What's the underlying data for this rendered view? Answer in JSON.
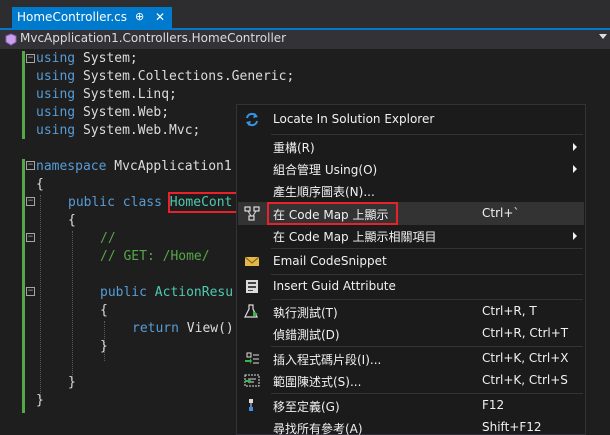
{
  "tab": {
    "filename": "HomeController.cs",
    "pin": "⊕",
    "close": "✕"
  },
  "navbar": {
    "path": "MvcApplication1.Controllers.HomeController"
  },
  "code": {
    "l1": [
      "using",
      " System;"
    ],
    "l2": [
      "using",
      " System.Collections.Generic;"
    ],
    "l3": [
      "using",
      " System.Linq;"
    ],
    "l4": [
      "using",
      " System.Web;"
    ],
    "l5": [
      "using",
      " System.Web.Mvc;"
    ],
    "l7": [
      "namespace",
      " MvcApplication1"
    ],
    "l8": "{",
    "l9": [
      "public",
      " ",
      "class",
      " ",
      "HomeCont"
    ],
    "l10": "{",
    "l11": "//",
    "l12": "// GET: /Home/",
    "l14": [
      "public",
      " ActionResu"
    ],
    "l15": "{",
    "l16": [
      "return",
      " View()"
    ],
    "l17": "}",
    "l19": "}",
    "l20": "}"
  },
  "menu": {
    "items": [
      {
        "label": "Locate In Solution Explorer",
        "shortcut": "",
        "icon": "sync-arrows-icon"
      },
      {
        "label": "重構(R)",
        "shortcut": "",
        "icon": "",
        "submenu": true
      },
      {
        "label": "組合管理 Using(O)",
        "shortcut": "",
        "icon": "",
        "submenu": true
      },
      {
        "label": "產生順序圖表(N)...",
        "shortcut": "",
        "icon": ""
      },
      {
        "label": "在 Code Map 上顯示",
        "shortcut": "Ctrl+`",
        "icon": "code-map-icon"
      },
      {
        "label": "在 Code Map 上顯示相關項目",
        "shortcut": "",
        "icon": "",
        "submenu": true
      },
      {
        "label": "Email CodeSnippet",
        "shortcut": "",
        "icon": "email-icon"
      },
      {
        "label": "Insert Guid Attribute",
        "shortcut": "",
        "icon": "guid-icon"
      },
      {
        "label": "執行測試(T)",
        "shortcut": "Ctrl+R, T",
        "icon": "run-tests-icon"
      },
      {
        "label": "偵錯測試(D)",
        "shortcut": "Ctrl+R, Ctrl+T",
        "icon": ""
      },
      {
        "label": "插入程式碼片段(I)...",
        "shortcut": "Ctrl+K, Ctrl+X",
        "icon": "insert-snippet-icon"
      },
      {
        "label": "範圍陳述式(S)...",
        "shortcut": "Ctrl+K, Ctrl+S",
        "icon": "surround-with-icon"
      },
      {
        "label": "移至定義(G)",
        "shortcut": "F12",
        "icon": "go-to-definition-icon"
      },
      {
        "label": "尋找所有參考(A)",
        "shortcut": "Shift+F12",
        "icon": ""
      }
    ]
  },
  "colors": {
    "accent": "#007acc",
    "keyword": "#569cd6",
    "type": "#4ec9b0",
    "comment": "#57a64a",
    "highlight_box": "#e8222b"
  }
}
